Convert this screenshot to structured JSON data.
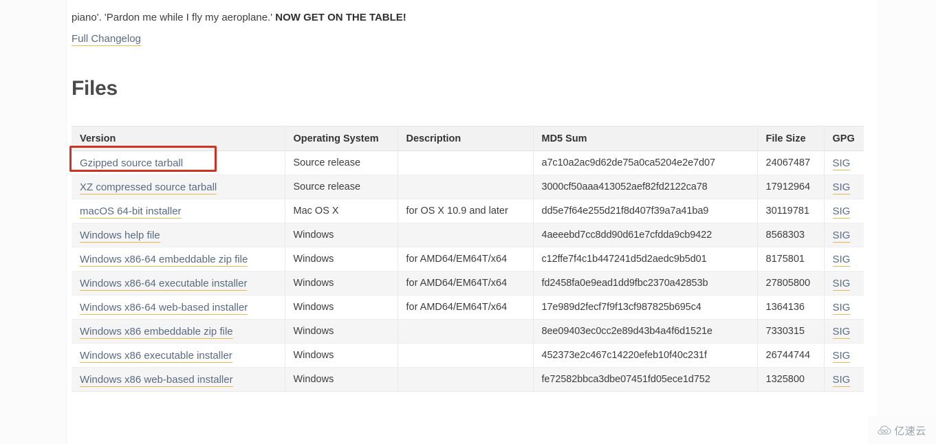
{
  "intro": {
    "text_normal": "piano'. 'Pardon me while I fly my aeroplane.' ",
    "text_bold": "NOW GET ON THE TABLE!"
  },
  "changelog_link": {
    "label": "Full Changelog"
  },
  "heading": {
    "files": "Files"
  },
  "table": {
    "columns": [
      "Version",
      "Operating System",
      "Description",
      "MD5 Sum",
      "File Size",
      "GPG"
    ],
    "rows": [
      {
        "version": "Gzipped source tarball",
        "os": "Source release",
        "description": "",
        "md5": "a7c10a2ac9d62de75a0ca5204e2e7d07",
        "size": "24067487",
        "gpg": "SIG"
      },
      {
        "version": "XZ compressed source tarball",
        "os": "Source release",
        "description": "",
        "md5": "3000cf50aaa413052aef82fd2122ca78",
        "size": "17912964",
        "gpg": "SIG"
      },
      {
        "version": "macOS 64-bit installer",
        "os": "Mac OS X",
        "description": "for OS X 10.9 and later",
        "md5": "dd5e7f64e255d21f8d407f39a7a41ba9",
        "size": "30119781",
        "gpg": "SIG"
      },
      {
        "version": "Windows help file",
        "os": "Windows",
        "description": "",
        "md5": "4aeeebd7cc8dd90d61e7cfdda9cb9422",
        "size": "8568303",
        "gpg": "SIG"
      },
      {
        "version": "Windows x86-64 embeddable zip file",
        "os": "Windows",
        "description": "for AMD64/EM64T/x64",
        "md5": "c12ffe7f4c1b447241d5d2aedc9b5d01",
        "size": "8175801",
        "gpg": "SIG"
      },
      {
        "version": "Windows x86-64 executable installer",
        "os": "Windows",
        "description": "for AMD64/EM64T/x64",
        "md5": "fd2458fa0e9ead1dd9fbc2370a42853b",
        "size": "27805800",
        "gpg": "SIG"
      },
      {
        "version": "Windows x86-64 web-based installer",
        "os": "Windows",
        "description": "for AMD64/EM64T/x64",
        "md5": "17e989d2fecf7f9f13cf987825b695c4",
        "size": "1364136",
        "gpg": "SIG"
      },
      {
        "version": "Windows x86 embeddable zip file",
        "os": "Windows",
        "description": "",
        "md5": "8ee09403ec0cc2e89d43b4a4f6d1521e",
        "size": "7330315",
        "gpg": "SIG"
      },
      {
        "version": "Windows x86 executable installer",
        "os": "Windows",
        "description": "",
        "md5": "452373e2c467c14220efeb10f40c231f",
        "size": "26744744",
        "gpg": "SIG"
      },
      {
        "version": "Windows x86 web-based installer",
        "os": "Windows",
        "description": "",
        "md5": "fe72582bbca3dbe07451fd05ece1d752",
        "size": "1325800",
        "gpg": "SIG"
      }
    ]
  },
  "annotation": {
    "highlight_target": "Gzipped source tarball",
    "color": "#cc3322"
  },
  "watermark": {
    "text": "亿速云",
    "icon": "cloud-icon"
  },
  "colors": {
    "link": "#5a6b80",
    "link_underline": "#e3b84d",
    "header_bg": "#f2f2f2",
    "row_alt_bg": "#f5f5f5",
    "highlight": "#cc3322"
  }
}
